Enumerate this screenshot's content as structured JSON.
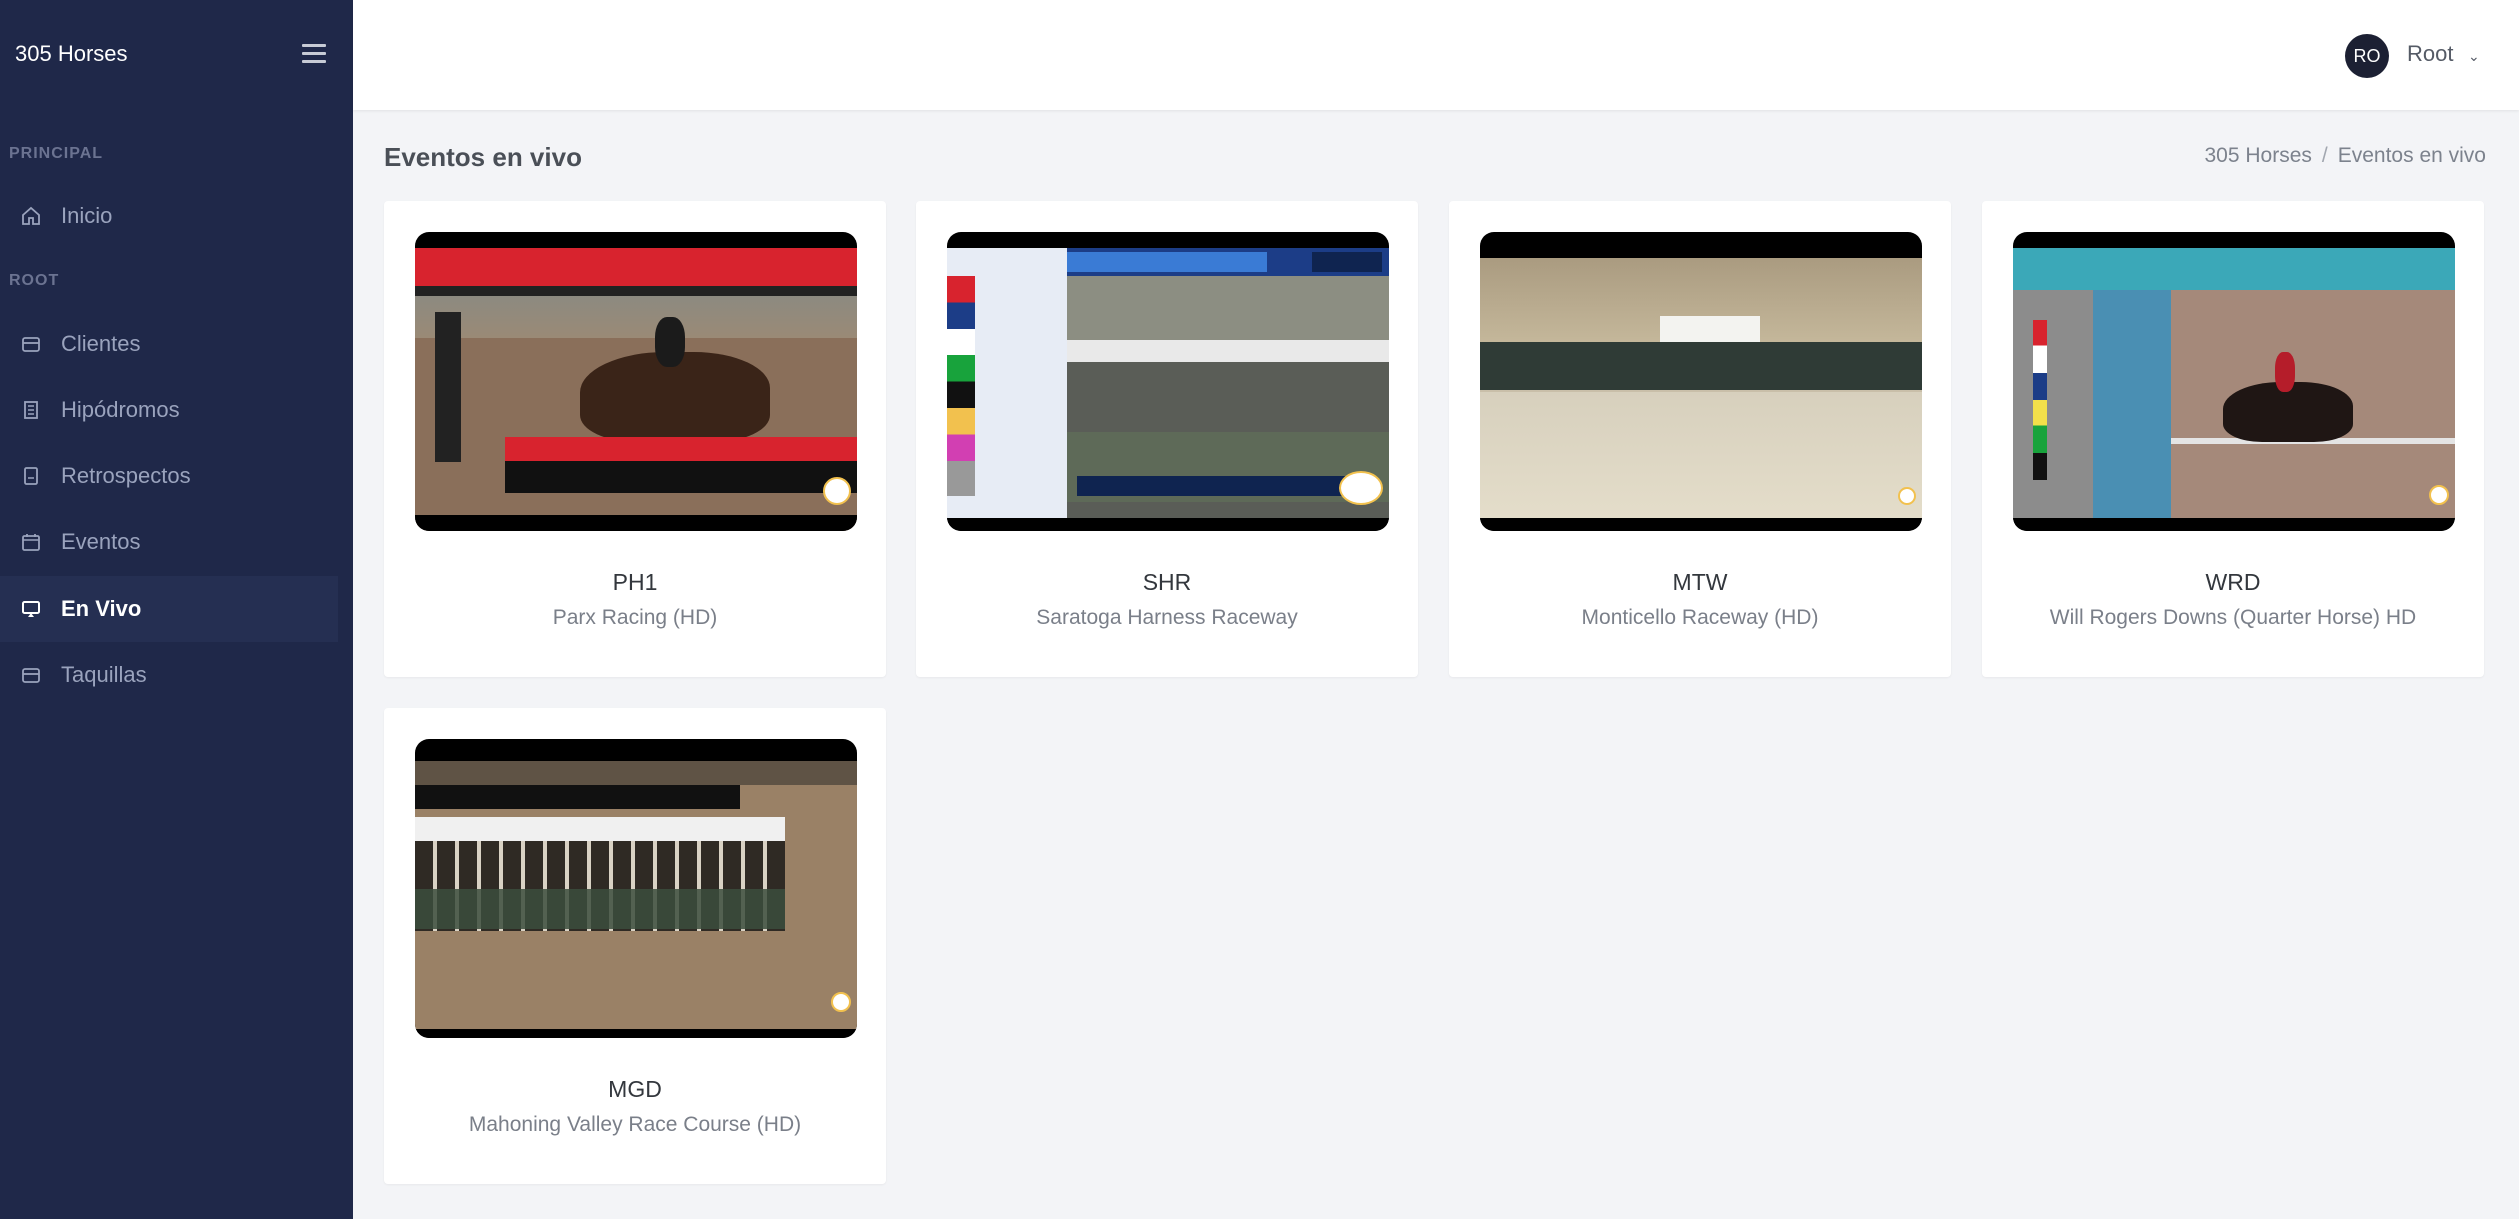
{
  "app": {
    "brand": "305 Horses"
  },
  "sidebar": {
    "sections": [
      {
        "label": "PRINCIPAL"
      },
      {
        "label": "ROOT"
      }
    ],
    "items": [
      {
        "label": "Inicio",
        "icon": "home-icon"
      },
      {
        "label": "Clientes",
        "icon": "box-icon"
      },
      {
        "label": "Hipódromos",
        "icon": "building-icon"
      },
      {
        "label": "Retrospectos",
        "icon": "document-icon"
      },
      {
        "label": "Eventos",
        "icon": "calendar-icon"
      },
      {
        "label": "En Vivo",
        "icon": "monitor-icon",
        "active": true
      },
      {
        "label": "Taquillas",
        "icon": "box-icon"
      }
    ]
  },
  "header": {
    "user_initials": "RO",
    "user_name": "Root"
  },
  "page": {
    "title": "Eventos en vivo"
  },
  "breadcrumb": [
    "305 Horses",
    "Eventos en vivo"
  ],
  "events": [
    {
      "code": "PH1",
      "track": "Parx Racing (HD)"
    },
    {
      "code": "SHR",
      "track": "Saratoga Harness Raceway"
    },
    {
      "code": "MTW",
      "track": "Monticello Raceway (HD)"
    },
    {
      "code": "WRD",
      "track": "Will Rogers Downs (Quarter Horse) HD"
    },
    {
      "code": "MGD",
      "track": "Mahoning Valley Race Course (HD)"
    }
  ],
  "colors": {
    "sidebar_bg": "#1f2849",
    "page_bg": "#f3f4f7",
    "accent": "#252f52"
  }
}
